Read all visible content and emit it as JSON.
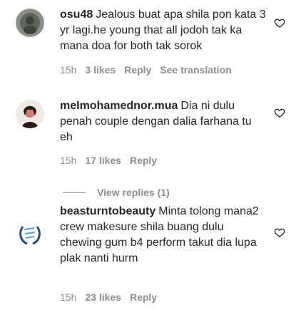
{
  "comments": [
    {
      "username": "osu48",
      "text": "Jealous buat apa shila pon kata 3 yr lagi.he young that all jodoh tak ka mana doa for both tak sorok",
      "time": "15h",
      "likes": "3 likes",
      "reply": "Reply",
      "translate": "See translation",
      "avatar_icon": "profile-photo"
    },
    {
      "username": "melmohamednor.mua",
      "text": "Dia ni dulu penah couple dengan dalia farhana tu eh",
      "time": "15h",
      "likes": "17 likes",
      "reply": "Reply",
      "avatar_icon": "profile-photo"
    },
    {
      "username": "beasturntobeauty",
      "text": "Minta tolong mana2 crew makesure shila buang dulu chewing gum b4 perform takut dia lupa plak nanti hurm",
      "time": "15h",
      "likes": "23 likes",
      "reply": "Reply",
      "avatar_icon": "profile-photo"
    }
  ],
  "view_replies": "View replies (1)",
  "heart_icon": "heart-outline-icon"
}
